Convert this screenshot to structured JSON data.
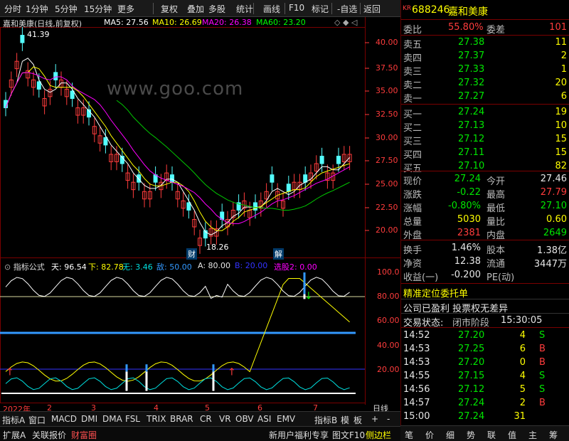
{
  "toolbar": {
    "items": [
      "分时",
      "1分钟",
      "5分钟",
      "15分钟",
      "更多",
      "复权",
      "叠加",
      "多股",
      "统计",
      "画线",
      "F10",
      "标记",
      "-自选",
      "返回"
    ]
  },
  "watermark": "www.goo.com",
  "main_chart": {
    "title": "嘉和美康(日线,前复权)",
    "ma": [
      {
        "label": "MA5: 27.56",
        "color": "#ffffff"
      },
      {
        "label": "MA10: 26.69",
        "color": "#ffff00"
      },
      {
        "label": "MA20: 26.38",
        "color": "#ff00ff"
      },
      {
        "label": "MA60: 23.20",
        "color": "#00ff00"
      }
    ],
    "high_mark": "41.39",
    "low_mark": "18.26",
    "note_cai": "财",
    "note_jie": "解",
    "price_axis": [
      "40.00",
      "37.50",
      "35.00",
      "32.50",
      "30.00",
      "27.50",
      "25.00",
      "22.50",
      "20.00"
    ]
  },
  "indicator": {
    "name": "指标公式",
    "items": [
      {
        "label": "天: 96.54",
        "color": "#ffffff"
      },
      {
        "label": "下: 82.78",
        "color": "#ffff00"
      },
      {
        "label": "无: 3.46",
        "color": "#00e0e0"
      },
      {
        "label": "敌: 50.00",
        "color": "#3399ff"
      },
      {
        "label": "A: 80.00",
        "color": "#e6e6e6"
      },
      {
        "label": "B: 20.00",
        "color": "#3333ff"
      },
      {
        "label": "选股2: 0.00",
        "color": "#ff00ff"
      }
    ],
    "axis": [
      "100.0",
      "80.00",
      "60.00",
      "40.00",
      "20.00"
    ]
  },
  "x_axis": {
    "labels": [
      "2022年",
      "2",
      "3",
      "4",
      "5",
      "6",
      "7"
    ],
    "unit": "日线"
  },
  "tabs": [
    "指标A",
    "窗口",
    "MACD",
    "DMI",
    "DMA",
    "FSL",
    "TRIX",
    "BRAR",
    "CR",
    "VR",
    "OBV",
    "ASI",
    "EMV",
    "指标B",
    "模",
    "板",
    "+",
    "-"
  ],
  "status_bar": {
    "left": [
      "扩展A",
      "关联报价",
      "财富圈"
    ],
    "right": [
      "新用户福利专享",
      "图文F10",
      "侧边栏"
    ]
  },
  "quote": {
    "market": "KR",
    "code": "688246",
    "name": "嘉和美康",
    "weibi_label": "委比",
    "weibi": "55.80%",
    "weicha_label": "委差",
    "weicha": "101",
    "sells": [
      {
        "label": "卖五",
        "price": "27.38",
        "vol": "11"
      },
      {
        "label": "卖四",
        "price": "27.37",
        "vol": "2"
      },
      {
        "label": "卖三",
        "price": "27.33",
        "vol": "1"
      },
      {
        "label": "卖二",
        "price": "27.32",
        "vol": "20"
      },
      {
        "label": "卖一",
        "price": "27.27",
        "vol": "6"
      }
    ],
    "buys": [
      {
        "label": "买一",
        "price": "27.24",
        "vol": "19"
      },
      {
        "label": "买二",
        "price": "27.13",
        "vol": "10"
      },
      {
        "label": "买三",
        "price": "27.12",
        "vol": "15"
      },
      {
        "label": "买四",
        "price": "27.11",
        "vol": "15"
      },
      {
        "label": "买五",
        "price": "27.10",
        "vol": "82"
      }
    ],
    "stats": [
      {
        "l1": "现价",
        "v1": "27.24",
        "c1": "green",
        "l2": "今开",
        "v2": "27.46",
        "c2": "white"
      },
      {
        "l1": "涨跌",
        "v1": "-0.22",
        "c1": "green",
        "l2": "最高",
        "v2": "27.79",
        "c2": "red"
      },
      {
        "l1": "涨幅",
        "v1": "-0.80%",
        "c1": "green",
        "l2": "最低",
        "v2": "27.10",
        "c2": "green"
      },
      {
        "l1": "总量",
        "v1": "5030",
        "c1": "yellow",
        "l2": "量比",
        "v2": "0.60",
        "c2": "yellow"
      },
      {
        "l1": "外盘",
        "v1": "2381",
        "c1": "red",
        "l2": "内盘",
        "v2": "2649",
        "c2": "green"
      }
    ],
    "stats2": [
      {
        "l1": "换手",
        "v1": "1.46%",
        "l2": "股本",
        "v2": "1.38亿"
      },
      {
        "l1": "净资",
        "v1": "12.38",
        "l2": "流通",
        "v2": "3447万"
      },
      {
        "l1": "收益(一)",
        "v1": "-0.200",
        "l2": "PE(动)",
        "v2": ""
      }
    ],
    "banner": "精准定位委托单",
    "notice": "公司已盈利 投票权无差异",
    "trade_status_label": "交易状态:",
    "trade_status": "闭市阶段",
    "trade_time": "15:30:05",
    "ticks": [
      {
        "time": "14:52",
        "price": "27.20",
        "vol": "4",
        "side": "S"
      },
      {
        "time": "14:53",
        "price": "27.25",
        "vol": "6",
        "side": "B"
      },
      {
        "time": "14:53",
        "price": "27.20",
        "vol": "0",
        "side": "B"
      },
      {
        "time": "14:55",
        "price": "27.15",
        "vol": "4",
        "side": "S"
      },
      {
        "time": "14:56",
        "price": "27.12",
        "vol": "5",
        "side": "S"
      },
      {
        "time": "14:57",
        "price": "27.24",
        "vol": "2",
        "side": "B"
      },
      {
        "time": "15:00",
        "price": "27.24",
        "vol": "31",
        "side": ""
      }
    ],
    "bottom_tabs": [
      "笔",
      "价",
      "细",
      "势",
      "联",
      "值",
      "主",
      "筹"
    ]
  }
}
